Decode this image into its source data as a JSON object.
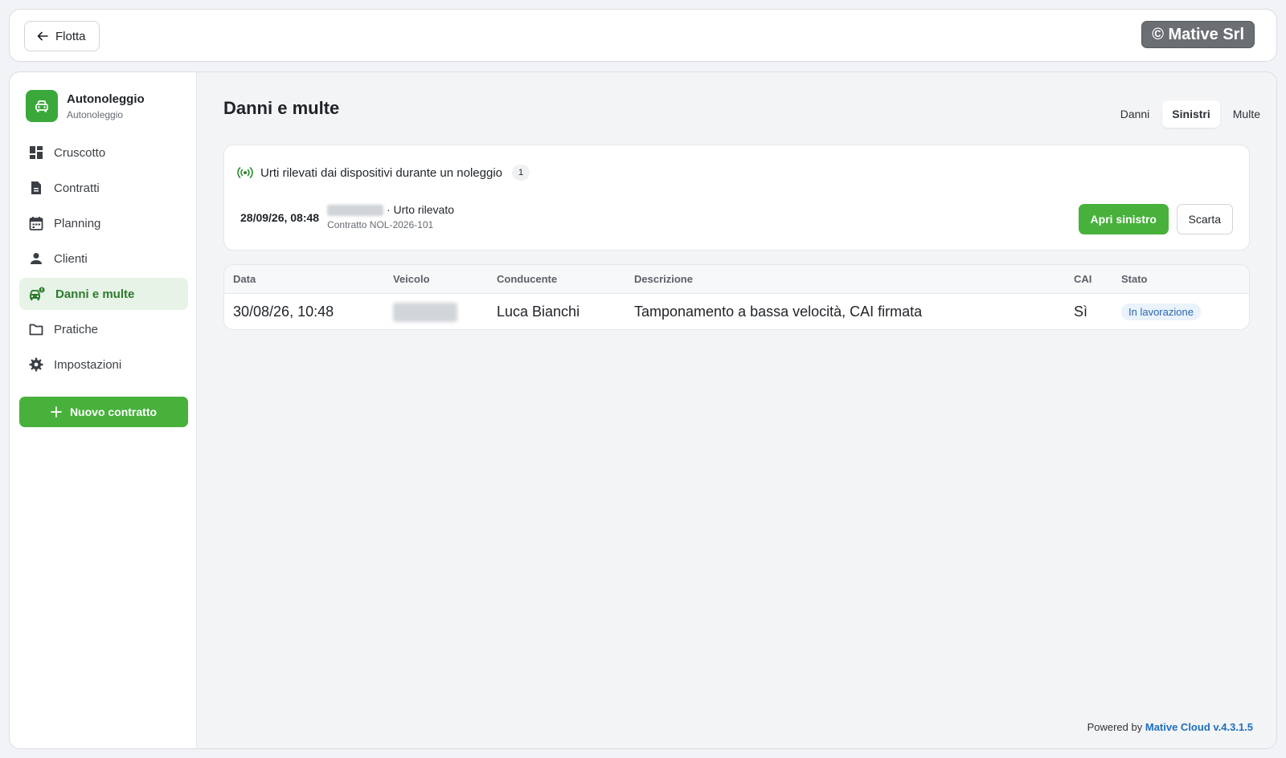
{
  "topbar": {
    "back_label": "Flotta",
    "brand": "© Mative Srl"
  },
  "sidebar": {
    "org_name": "Autonoleggio",
    "org_sub": "Autonoleggio",
    "items": [
      {
        "label": "Cruscotto",
        "icon": "dashboard-icon"
      },
      {
        "label": "Contratti",
        "icon": "document-icon"
      },
      {
        "label": "Planning",
        "icon": "calendar-icon"
      },
      {
        "label": "Clienti",
        "icon": "person-icon"
      },
      {
        "label": "Danni e multe",
        "icon": "car-damage-icon",
        "active": true
      },
      {
        "label": "Pratiche",
        "icon": "folder-icon"
      },
      {
        "label": "Impostazioni",
        "icon": "gear-icon"
      }
    ],
    "new_contract_label": "Nuovo contratto"
  },
  "main": {
    "title": "Danni e multe",
    "tabs": [
      {
        "label": "Danni",
        "active": false
      },
      {
        "label": "Sinistri",
        "active": true
      },
      {
        "label": "Multe",
        "active": false
      }
    ],
    "alert": {
      "heading": "Urti rilevati dai dispositivi durante un noleggio",
      "count": "1",
      "time": "28/09/26, 08:48",
      "event": "· Urto rilevato",
      "contract": "Contratto NOL-2026-101",
      "open_label": "Apri sinistro",
      "discard_label": "Scarta"
    },
    "table": {
      "headers": [
        "Data",
        "Veicolo",
        "Conducente",
        "Descrizione",
        "CAI",
        "Stato"
      ],
      "rows": [
        {
          "data": "30/08/26, 10:48",
          "conducente": "Luca Bianchi",
          "descrizione": "Tamponamento a bassa velocità, CAI firmata",
          "cai": "Sì",
          "stato": "In lavorazione"
        }
      ]
    }
  },
  "footer": {
    "prefix": "Powered by",
    "product": "Mative Cloud v.4.3.1.5"
  },
  "colors": {
    "accent_green": "#47b13b",
    "active_nav_bg": "#e7f3e6",
    "status_blue": "#2a67b0"
  }
}
